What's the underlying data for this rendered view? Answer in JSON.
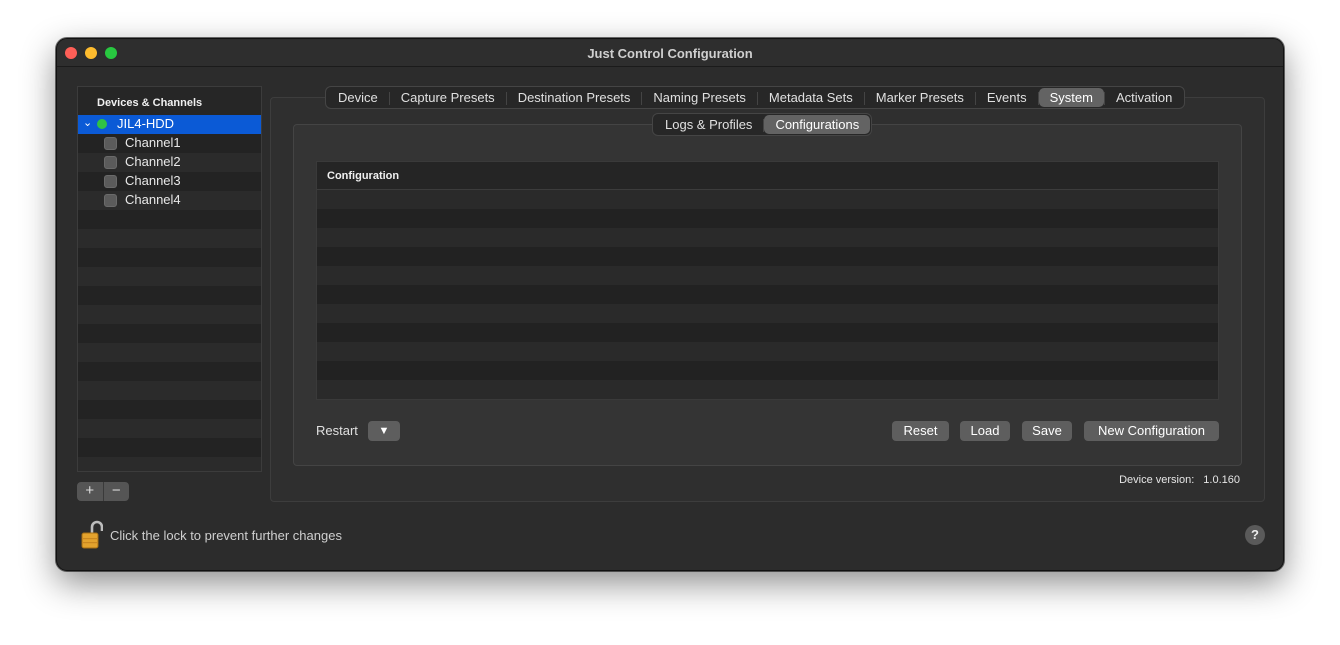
{
  "window": {
    "title": "Just Control Configuration"
  },
  "sidebar": {
    "header": "Devices & Channels",
    "device": {
      "name": "JIL4-HDD",
      "status_color": "#30c244"
    },
    "channels": [
      "Channel1",
      "Channel2",
      "Channel3",
      "Channel4"
    ],
    "add_label": "+",
    "remove_label": "−"
  },
  "tabs": [
    "Device",
    "Capture Presets",
    "Destination Presets",
    "Naming Presets",
    "Metadata Sets",
    "Marker Presets",
    "Events",
    "System",
    "Activation"
  ],
  "active_tab": "System",
  "subtabs": [
    "Logs & Profiles",
    "Configurations"
  ],
  "active_subtab": "Configurations",
  "table": {
    "header": "Configuration",
    "rows": []
  },
  "actions": {
    "restart_label": "Restart",
    "restart_dropdown": "▼",
    "reset": "Reset",
    "load": "Load",
    "save": "Save",
    "new_configuration": "New Configuration"
  },
  "device_version": {
    "label": "Device version:",
    "value": "1.0.160"
  },
  "footer": {
    "lock_text": "Click the lock to prevent further changes",
    "help": "?"
  },
  "colors": {
    "selection": "#0b5ad6",
    "accent_lock": "#e3a22d"
  }
}
